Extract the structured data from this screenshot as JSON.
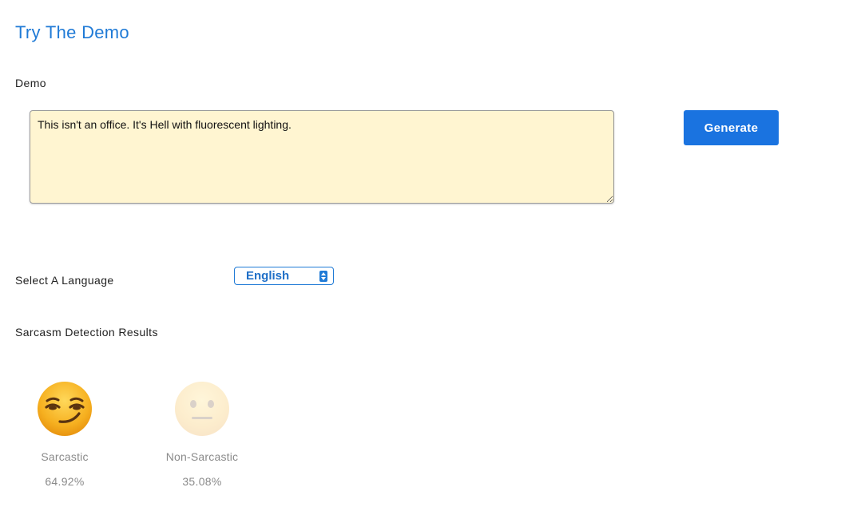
{
  "page": {
    "title": "Try The Demo"
  },
  "demo": {
    "label": "Demo",
    "input_value": "This isn't an office. It's Hell with fluorescent lighting.",
    "generate_label": "Generate"
  },
  "language": {
    "label": "Select A Language",
    "selected": "English"
  },
  "results": {
    "label": "Sarcasm Detection Results",
    "items": [
      {
        "label": "Sarcastic",
        "percent": "64.92%",
        "icon": "smirking-face-icon",
        "highlighted": true
      },
      {
        "label": "Non-Sarcastic",
        "percent": "35.08%",
        "icon": "neutral-face-icon",
        "highlighted": false
      }
    ]
  },
  "colors": {
    "accent": "#1a73e0",
    "title": "#1f7ad6",
    "textarea_bg": "#fff5d1",
    "muted_text": "#8a8a8a"
  }
}
